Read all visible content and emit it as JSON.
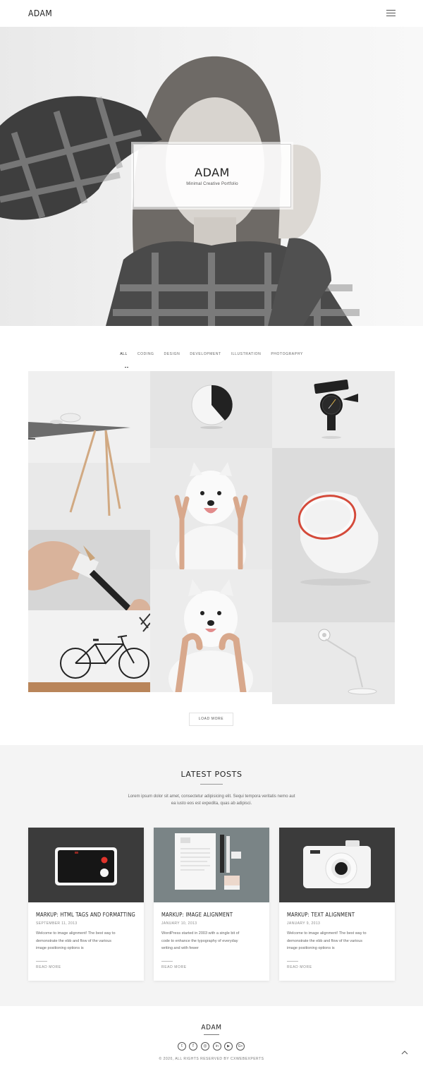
{
  "header": {
    "logo": "ADAM"
  },
  "hero": {
    "title": "ADAM",
    "subtitle": "Minimal Creative Portfolio"
  },
  "filters": [
    {
      "label": "ALL",
      "active": true
    },
    {
      "label": "CODING"
    },
    {
      "label": "DESIGN"
    },
    {
      "label": "DEVELOPMENT"
    },
    {
      "label": "ILLUSTRATION"
    },
    {
      "label": "PHOTOGRAPHY"
    }
  ],
  "gallery": [
    {
      "subject": "table"
    },
    {
      "subject": "clock"
    },
    {
      "subject": "watch"
    },
    {
      "subject": "dog-peace"
    },
    {
      "subject": "white-lamp"
    },
    {
      "subject": "pencil-sharpener"
    },
    {
      "subject": "bicycle"
    },
    {
      "subject": "dog-hands"
    },
    {
      "subject": "desk-lamp"
    }
  ],
  "load_more_label": "LOAD MORE",
  "posts": {
    "title": "LATEST POSTS",
    "description_line1": "Lorem ipsum dolor sit amet, consectetur adipisicing elit. Sequi tempora veritatis nemo aut",
    "description_line2": "ea iusto eos est expedita, quas ab adipisci.",
    "items": [
      {
        "title": "MARKUP: HTML TAGS AND FORMATTING",
        "date": "SEPTEMBER 11, 2013",
        "excerpt_l1": "Welcome to image alignment! The best way to",
        "excerpt_l2": "demonstrate the ebb and flow of the various",
        "excerpt_l3": "image positioning options is",
        "more": "READ MORE"
      },
      {
        "title": "MARKUP: IMAGE ALIGNMENT",
        "date": "JANUARY 10, 2013",
        "excerpt_l1": "WordPress started in 2003 with a single bit of",
        "excerpt_l2": "code to enhance the typography of everyday",
        "excerpt_l3": "writing and with fewer",
        "more": "READ MORE"
      },
      {
        "title": "MARKUP: TEXT ALIGNMENT",
        "date": "JANUARY 9, 2013",
        "excerpt_l1": "Welcome to image alignment! The best way to",
        "excerpt_l2": "demonstrate the ebb and flow of the various",
        "excerpt_l3": "image positioning options is",
        "more": "READ MORE"
      }
    ]
  },
  "footer": {
    "logo": "ADAM",
    "social": [
      {
        "icon": "twitter-icon",
        "glyph": "t"
      },
      {
        "icon": "facebook-icon",
        "glyph": "f"
      },
      {
        "icon": "instagram-icon",
        "glyph": "◎"
      },
      {
        "icon": "linkedin-icon",
        "glyph": "in"
      },
      {
        "icon": "youtube-icon",
        "glyph": "▶"
      },
      {
        "icon": "googleplus-icon",
        "glyph": "G+"
      }
    ],
    "copyright": "© 2020, ALL RIGHTS RESERVED BY CXWEBEXPERTS"
  }
}
